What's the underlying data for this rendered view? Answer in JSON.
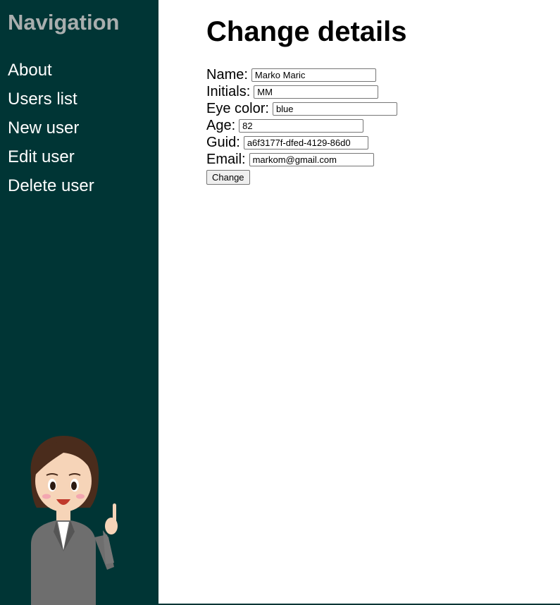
{
  "sidebar": {
    "title": "Navigation",
    "items": [
      {
        "label": "About"
      },
      {
        "label": "Users list"
      },
      {
        "label": "New user"
      },
      {
        "label": "Edit user"
      },
      {
        "label": "Delete user"
      }
    ],
    "background_color": "#003535",
    "title_color": "#a9aeae"
  },
  "main": {
    "title": "Change details",
    "fields": [
      {
        "label": "Name:",
        "value": "Marko Maric"
      },
      {
        "label": "Initials:",
        "value": "MM"
      },
      {
        "label": "Eye color:",
        "value": "blue"
      },
      {
        "label": "Age:",
        "value": "82"
      },
      {
        "label": "Guid:",
        "value": "a6f3177f-dfed-4129-86d0"
      },
      {
        "label": "Email:",
        "value": "markom@gmail.com"
      }
    ],
    "submit_label": "Change"
  },
  "illustration": "businesswoman-pointing-up"
}
